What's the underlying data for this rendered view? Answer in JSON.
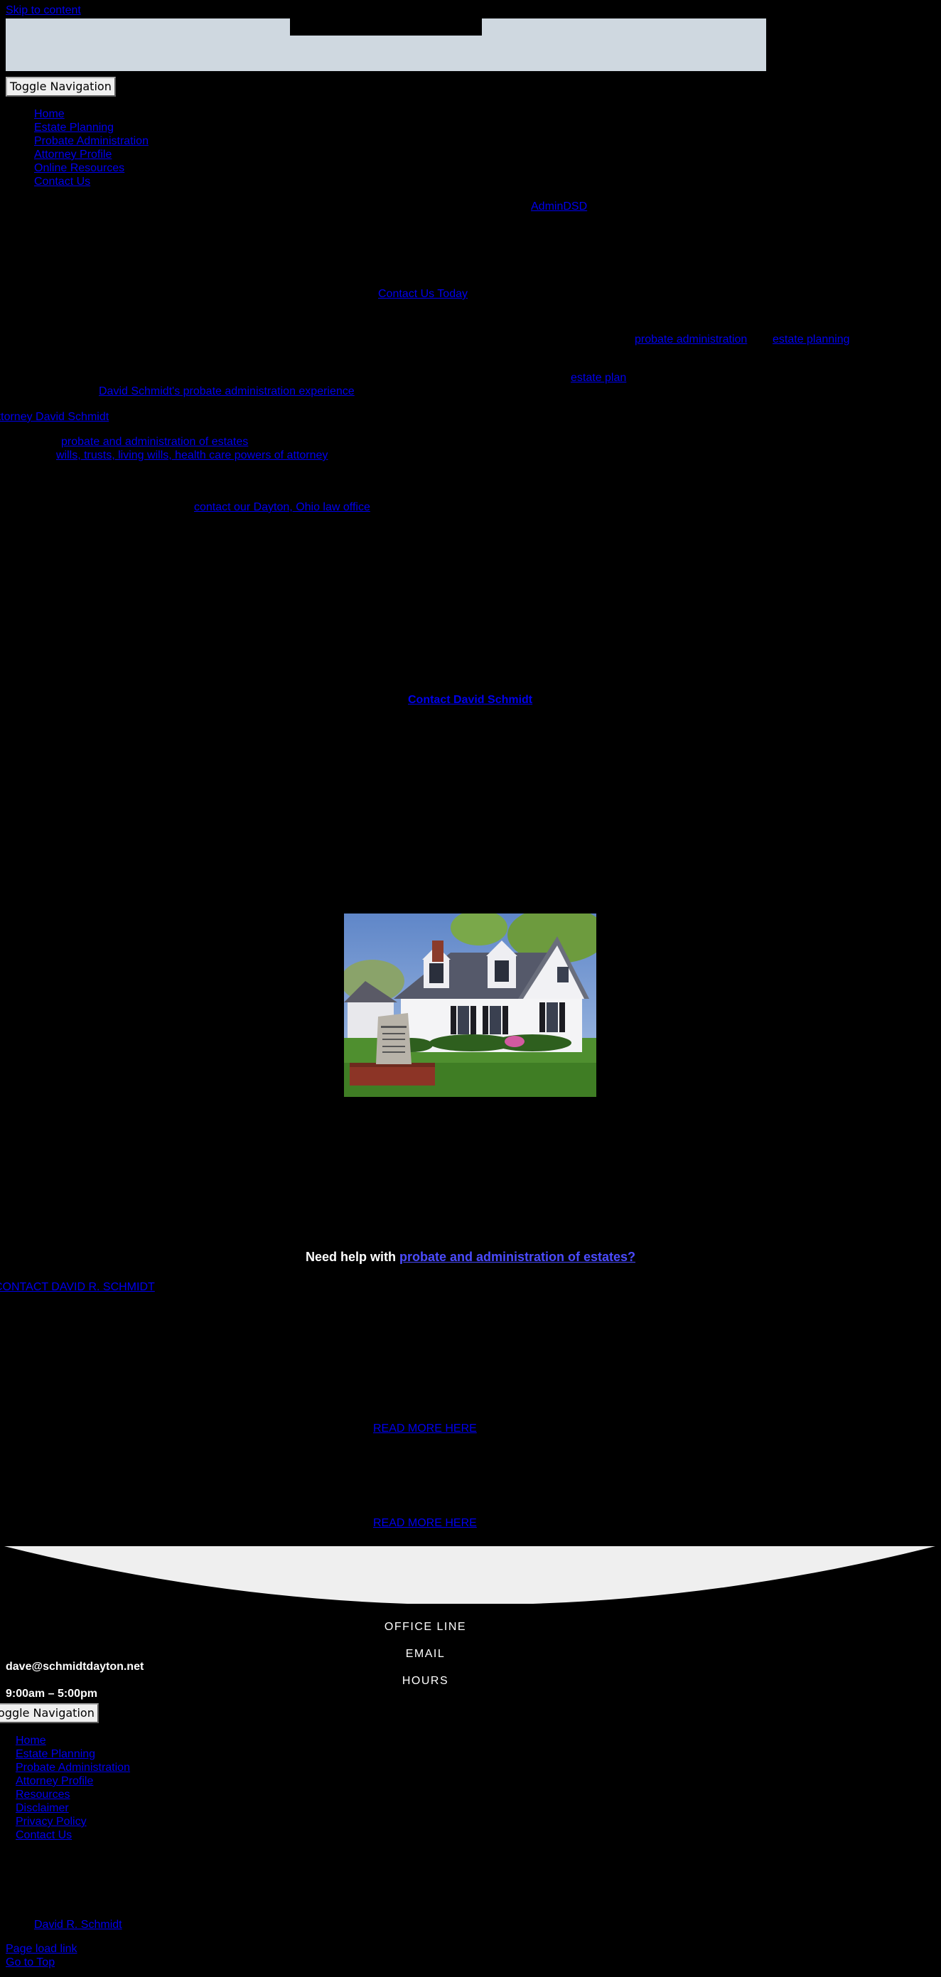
{
  "skip_link": "Skip to content",
  "header": {
    "toggle_label": "Toggle Navigation",
    "nav": [
      "Home",
      "Estate Planning",
      "Probate Administration",
      "Attorney Profile",
      "Online Resources",
      "Contact Us"
    ]
  },
  "content": {
    "author_link": "AdminDSD",
    "cta_link": "Contact Us Today",
    "probate_link": "probate administration",
    "estate_planning_link": "estate planning",
    "estate_plan_link": "estate plan",
    "experience_link": "David Schmidt's probate administration experience",
    "attorney_link": "Attorney David Schmidt",
    "probate_estates_link": "probate and administration of estates",
    "wills_link": "wills, trusts, living wills, health care powers of attorney",
    "office_link": "contact our Dayton, Ohio law office",
    "contact_david_link": "Contact David Schmidt",
    "photo_alt": "David Schmidt law office building"
  },
  "help": {
    "prefix": "Need help with ",
    "link": "probate and administration of estates?"
  },
  "contact_schmidt_link": "CONTACT DAVID R. SCHMIDT",
  "read_more_1": "READ MORE HERE",
  "read_more_2": "READ MORE HERE",
  "footer": {
    "office_line_label": "OFFICE LINE",
    "email_label": "EMAIL",
    "email_value": "dave@schmidtdayton.net",
    "hours_label": "HOURS",
    "hours_value": "9:00am – 5:00pm",
    "toggle_label": "Toggle Navigation",
    "nav": [
      "Home",
      "Estate Planning",
      "Probate Administration",
      "Attorney Profile",
      "Resources",
      "Disclaimer",
      "Privacy Policy",
      "Contact Us"
    ],
    "credit_link": "David R. Schmidt",
    "page_load_link": "Page load link",
    "go_top_link": "Go to Top"
  },
  "colors": {
    "background": "#000000",
    "header_bar": "#cfd8e0",
    "link": "#0000ee",
    "curve": "#efefef"
  }
}
